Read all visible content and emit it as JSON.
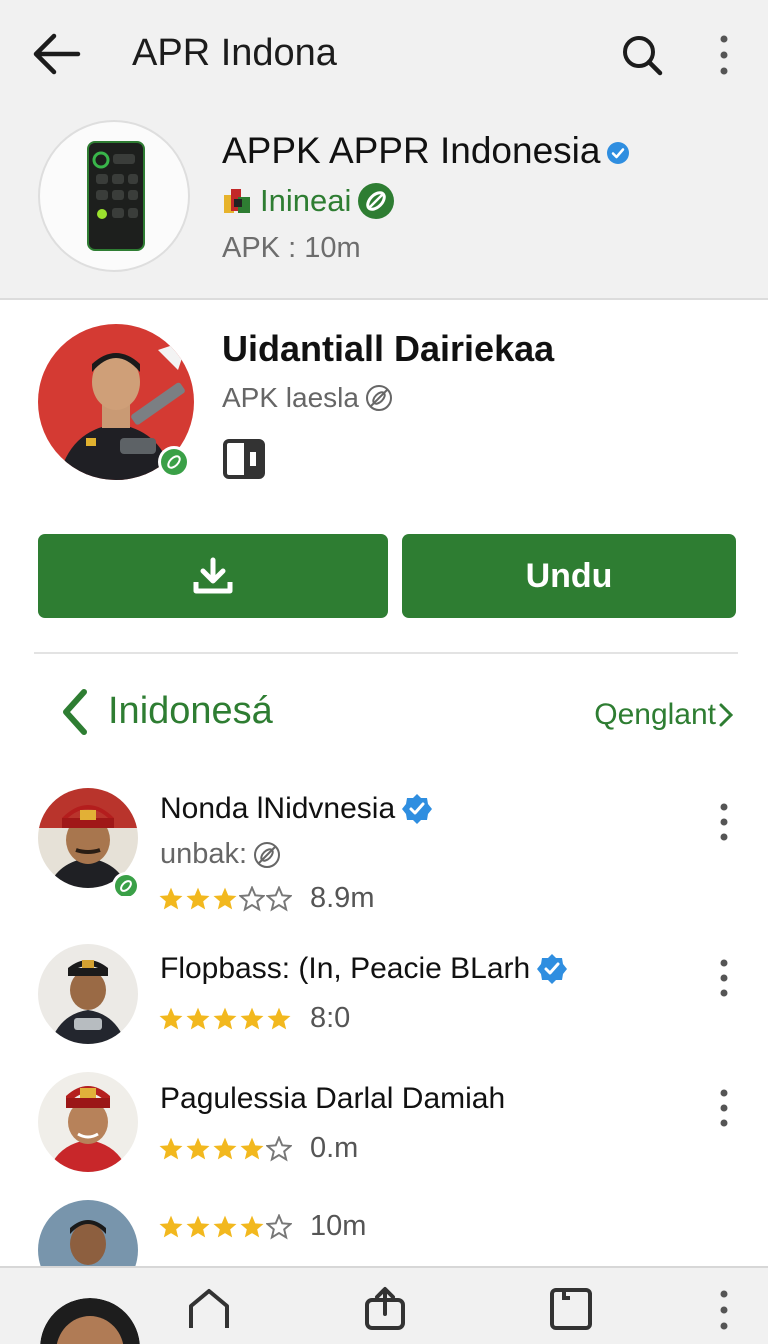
{
  "topbar": {
    "title": "APR Indona",
    "back_icon": "arrow-left-icon",
    "search_icon": "search-icon",
    "more_icon": "more-vertical-icon"
  },
  "app": {
    "name": "APPK APPR Indonesia",
    "developer": "Inineai",
    "size": "APK : 10m"
  },
  "feature": {
    "title": "Uidantiall Dairiekaa",
    "subtitle": "APK laesla",
    "download_icon": "download-icon",
    "install_label": "Undu"
  },
  "section": {
    "title": "Inidonesá",
    "link": "Qenglant"
  },
  "list": [
    {
      "name": "Nonda lNidvnesia",
      "verified": true,
      "sub": "unbak:",
      "rating": 3,
      "value": "8.9m"
    },
    {
      "name": "Flopbass: (In, Peacie BLarh",
      "verified": true,
      "sub": "",
      "rating": 5,
      "value": "8:0"
    },
    {
      "name": "Pagulessia  Darlal Damiah",
      "verified": false,
      "sub": "",
      "rating": 4,
      "value": "0.m"
    },
    {
      "name": "",
      "verified": false,
      "sub": "",
      "rating": 4,
      "value": "10m"
    }
  ],
  "colors": {
    "accent": "#2e7d32",
    "verified": "#2f8ee0",
    "star": "#f2b81e"
  },
  "bottom_nav": [
    "home-icon",
    "share-icon",
    "tablet-icon",
    "more-vertical-icon"
  ]
}
